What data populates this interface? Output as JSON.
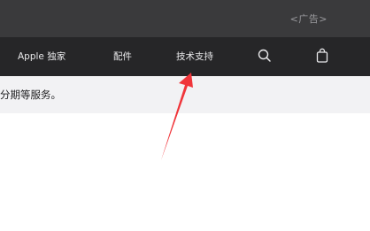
{
  "top_bar": {
    "ad_label": "<广告>"
  },
  "nav": {
    "items": [
      {
        "label": "Apple 独家"
      },
      {
        "label": "配件"
      },
      {
        "label": "技术支持"
      }
    ],
    "icons": [
      "search-icon",
      "bag-icon"
    ]
  },
  "banner": {
    "text": "分期等服务。"
  },
  "colors": {
    "top_bar": "#3a3a3c",
    "nav_bar": "#262628",
    "banner": "#f2f2f4",
    "annotation_arrow": "#f0353a"
  }
}
